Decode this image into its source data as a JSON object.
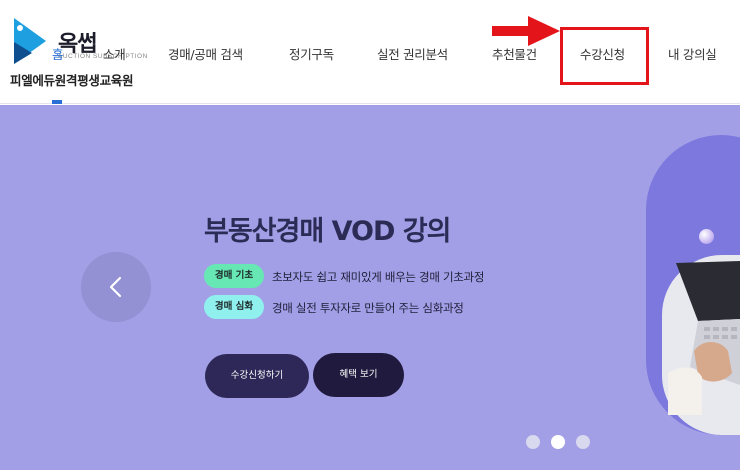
{
  "header": {
    "logo_text": "옥썹",
    "logo_subtext": "AUCTION SUBSCRIPTION",
    "org_name": "피엘에듀원격평생교육원",
    "nav": {
      "home": "홈",
      "about": "소개",
      "search": "경매/공매 검색",
      "subscription": "정기구독",
      "rights_analysis": "실전 권리분석",
      "recommended": "추천물건",
      "enroll": "수강신청",
      "my_courses": "내 강의실"
    }
  },
  "hero": {
    "title": "부동산경매 VOD 강의",
    "courses": [
      {
        "badge": "경매 기초",
        "description": "초보자도 쉽고 재미있게 배우는 경매 기초과정"
      },
      {
        "badge": "경매 심화",
        "description": "경매 실전 투자자로 만들어 주는 심화과정"
      }
    ],
    "enroll_button": "수강신청하기",
    "benefit_button": "혜택 보기"
  },
  "carousel": {
    "dot_count": 3,
    "active_dot": 2
  },
  "colors": {
    "hero_bg": "#a39fe6",
    "highlight_box": "#e4141b",
    "active_nav": "#2a6fd6",
    "badge_basic": "#66e7b4",
    "badge_advanced": "#8ff0ee"
  },
  "icons": {
    "prev": "chevron-left-icon",
    "arrow": "red-arrow-right-icon",
    "logo": "logo-play-icon"
  }
}
